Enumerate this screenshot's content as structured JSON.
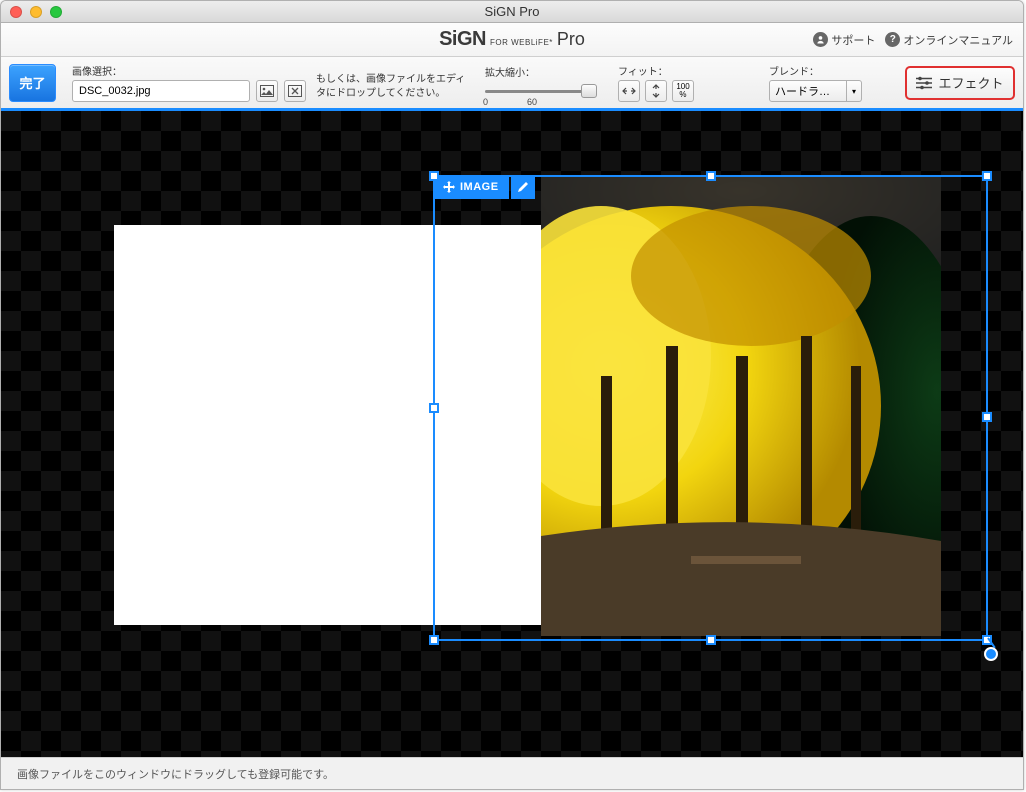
{
  "window": {
    "title": "SiGN Pro"
  },
  "brand": {
    "sign": "SiGN",
    "for": "FOR WEBLiFE*",
    "pro": "Pro"
  },
  "header_links": {
    "support": "サポート",
    "manual": "オンラインマニュアル"
  },
  "toolbar": {
    "done": "完了",
    "image_select_label": "画像選択：",
    "filename": "DSC_0032.jpg",
    "hint": "もしくは、画像ファイルをエディタにドロップしてください。",
    "zoom_label": "拡大縮小：",
    "zoom_min": "0",
    "zoom_mid": "60",
    "fit_label": "フィット：",
    "fit_100": "100\n%",
    "blend_label": "ブレンド：",
    "blend_value": "ハードラ…",
    "effect": "エフェクト"
  },
  "selection": {
    "tag": "IMAGE"
  },
  "status": {
    "text": "画像ファイルをこのウィンドウにドラッグしても登録可能です。"
  }
}
